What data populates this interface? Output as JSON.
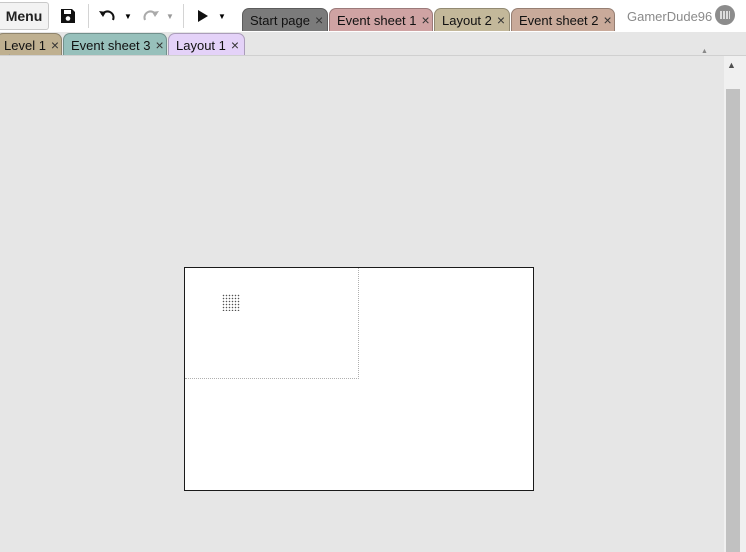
{
  "toolbar": {
    "menu_label": "Menu",
    "icons": [
      "save-icon",
      "undo-icon",
      "redo-icon",
      "play-icon"
    ]
  },
  "tabs_row1": [
    {
      "label": "Start page",
      "color": "#7b7b7b"
    },
    {
      "label": "Event sheet 1",
      "color": "#cfa3a3"
    },
    {
      "label": "Layout 2",
      "color": "#c3b89a"
    },
    {
      "label": "Event sheet 2",
      "color": "#c9aa9a"
    }
  ],
  "tabs_row2": [
    {
      "label": "Level 1",
      "color": "#bfb090"
    },
    {
      "label": "Event sheet 3",
      "color": "#97c0bb"
    },
    {
      "label": "Layout 1",
      "color": "#e4d2f8"
    }
  ],
  "close_glyph": "×",
  "user": {
    "name": "GamerDude96"
  }
}
